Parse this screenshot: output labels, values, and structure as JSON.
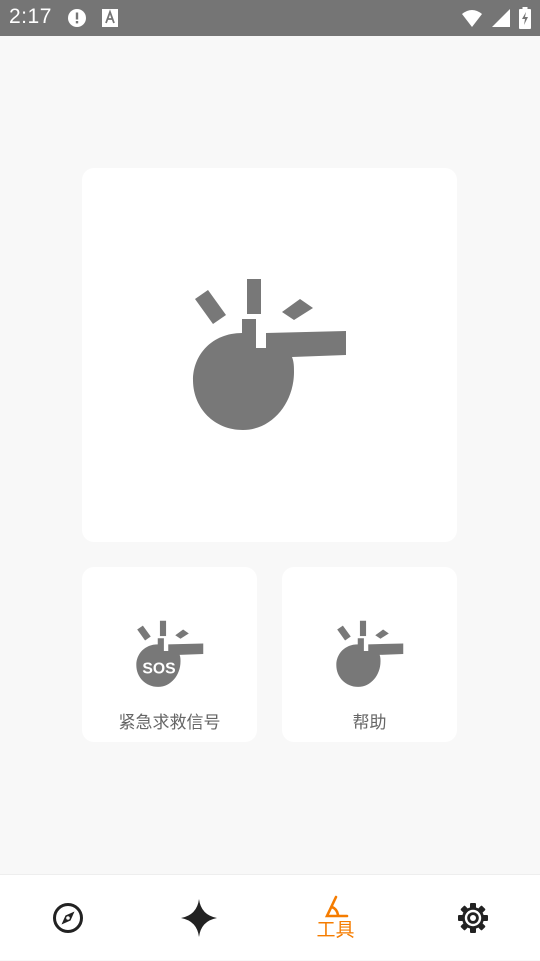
{
  "status_bar": {
    "time": "2:17",
    "left_icons": [
      "alert-icon",
      "keyboard-a-icon"
    ],
    "right_icons": [
      "wifi-icon",
      "signal-icon",
      "battery-charging-icon"
    ],
    "background": "#757575"
  },
  "main": {
    "whistle_color": "#787878",
    "cards": [
      {
        "label": "紧急求救信号",
        "badge": "SOS",
        "icon": "sos-whistle-icon"
      },
      {
        "label": "帮助",
        "icon": "whistle-icon"
      }
    ]
  },
  "bottom_nav": {
    "active_color": "#f57c00",
    "items": [
      {
        "icon": "compass-icon",
        "label": ""
      },
      {
        "icon": "sparkle-icon",
        "label": ""
      },
      {
        "icon": "tools-icon",
        "label": "工具",
        "active": true
      },
      {
        "icon": "gear-icon",
        "label": ""
      }
    ]
  }
}
